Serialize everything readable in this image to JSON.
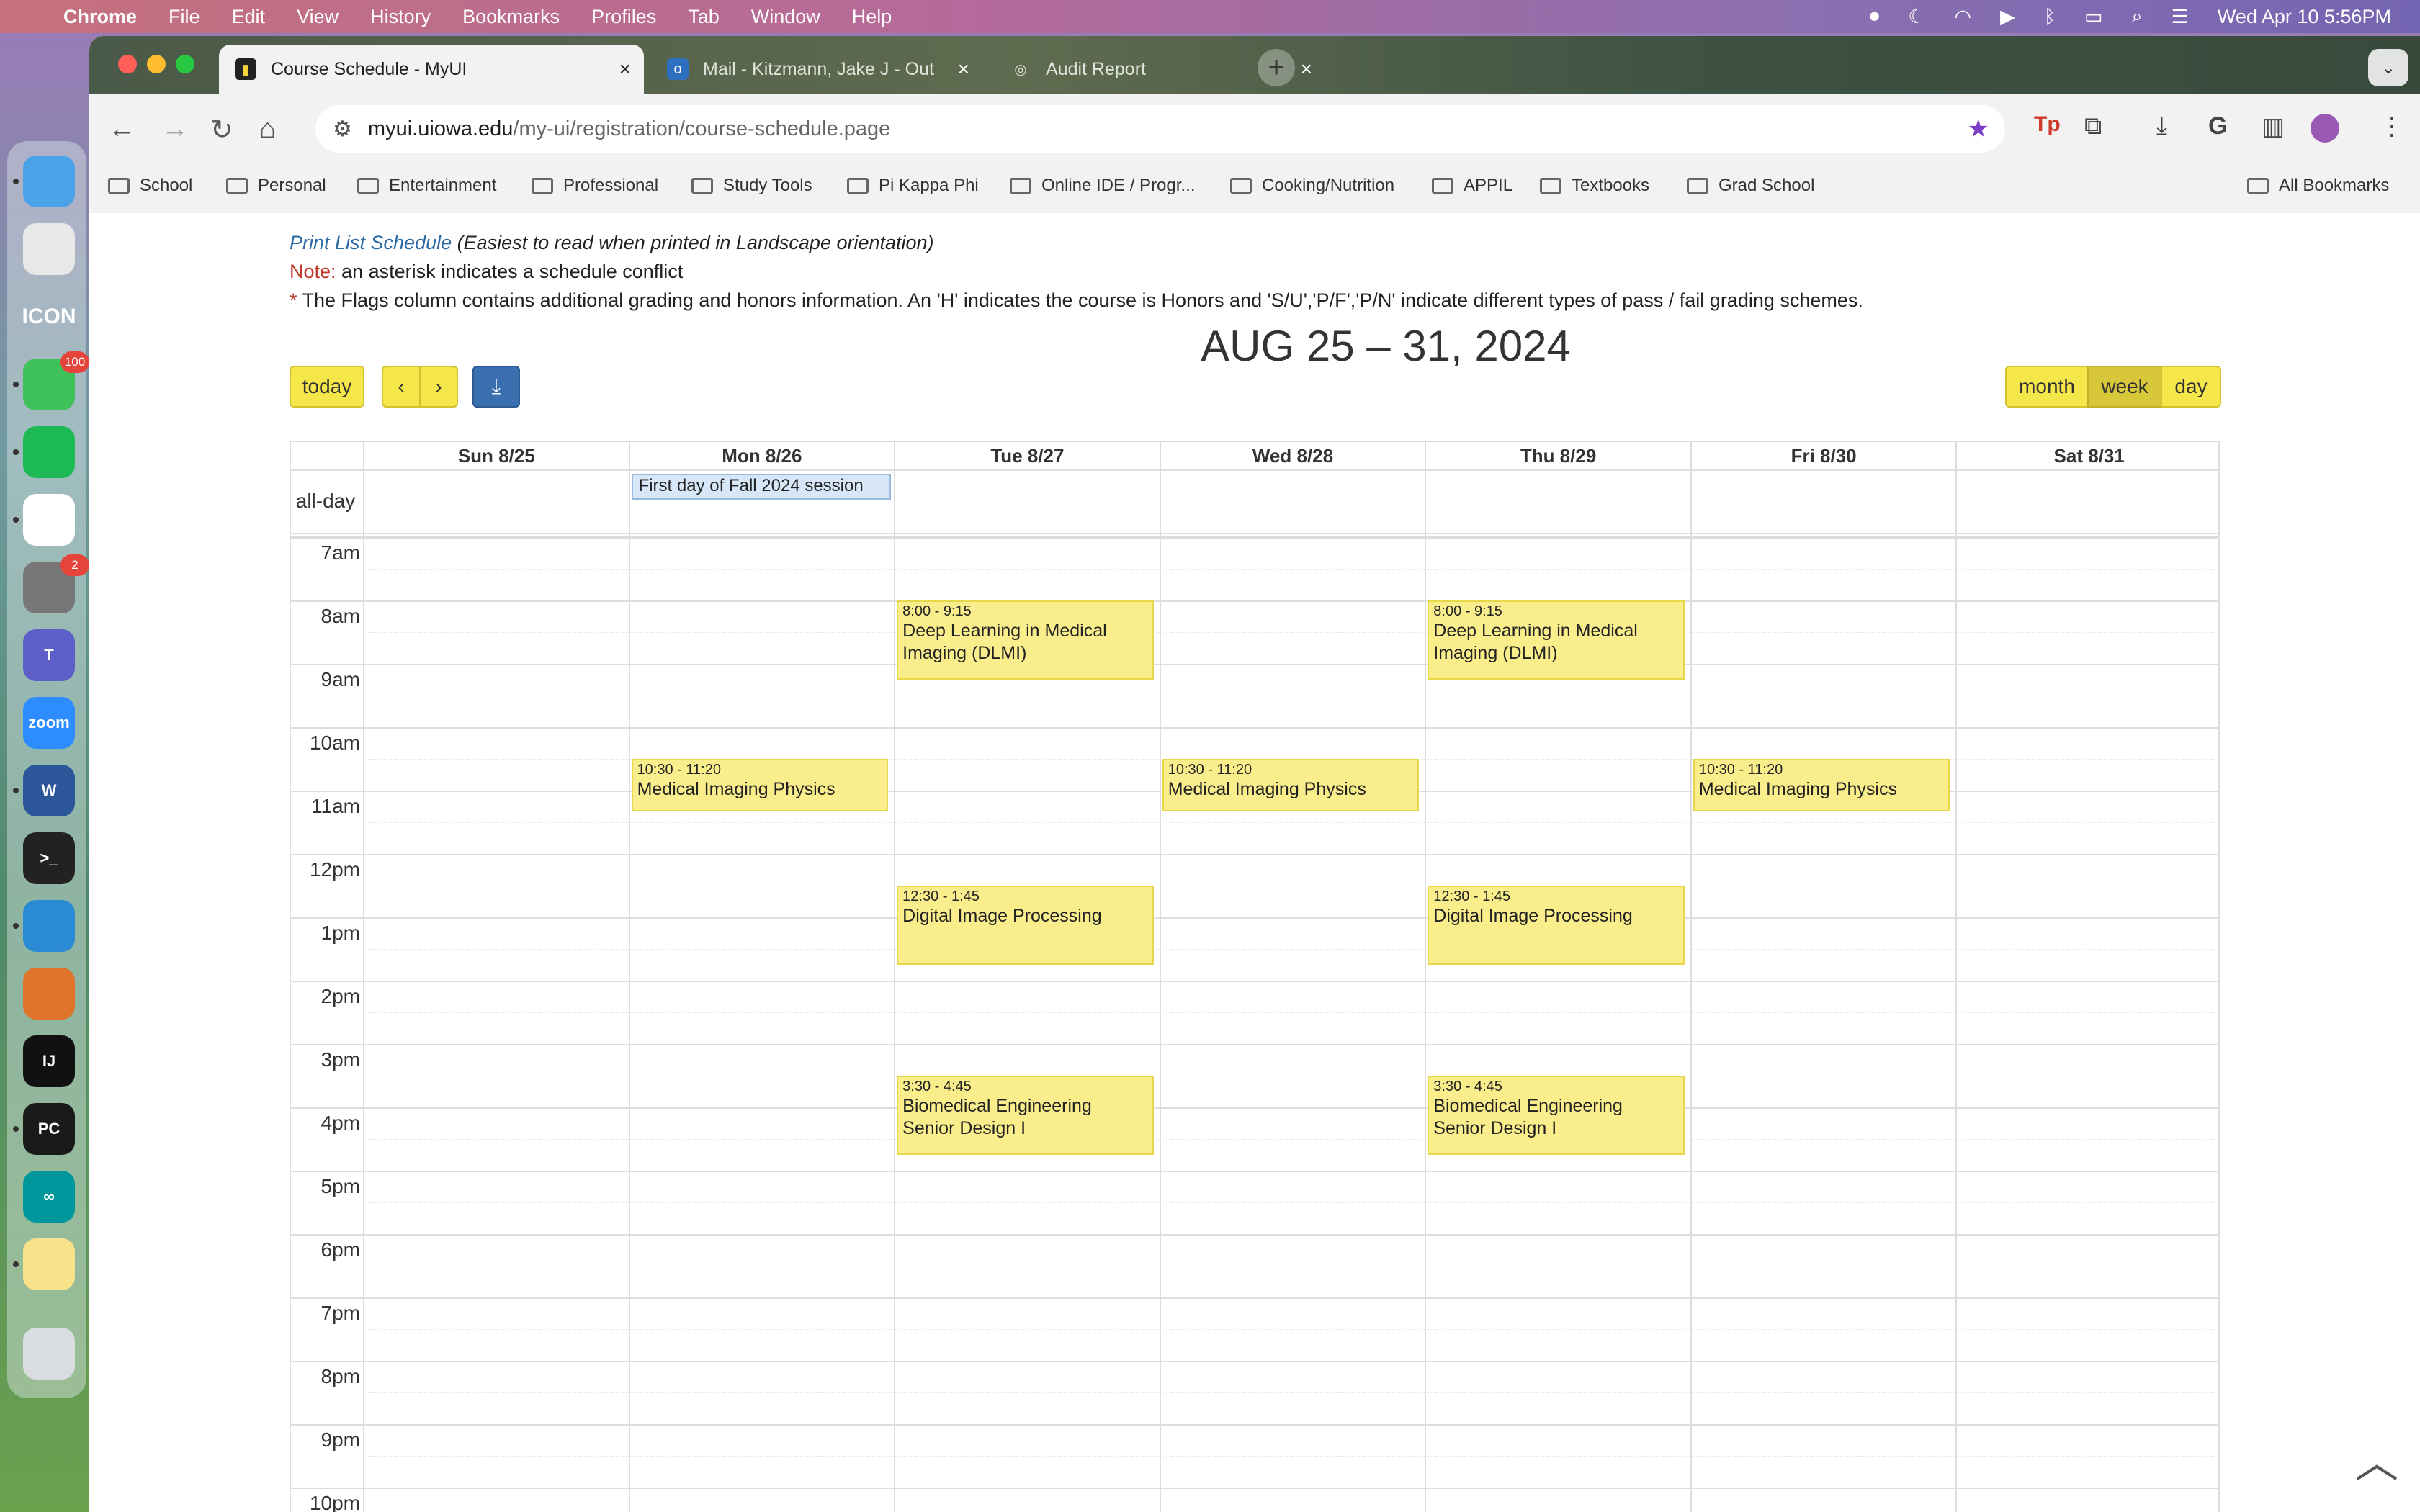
{
  "menubar": {
    "app": "Chrome",
    "items": [
      "File",
      "Edit",
      "View",
      "History",
      "Bookmarks",
      "Profiles",
      "Tab",
      "Window",
      "Help"
    ],
    "datetime": "Wed Apr 10  5:56PM"
  },
  "dock": {
    "apps": [
      {
        "name": "finder-icon",
        "label": "",
        "color": "#4aa3e8"
      },
      {
        "name": "launchpad-icon",
        "label": "",
        "color": "#e8e8e8"
      },
      {
        "name": "icon-app-icon",
        "label": "ICON",
        "color": "transparent"
      },
      {
        "name": "messages-icon",
        "label": "",
        "color": "#3fc15a",
        "badge": "100"
      },
      {
        "name": "spotify-icon",
        "label": "",
        "color": "#1db954"
      },
      {
        "name": "chrome-icon",
        "label": "",
        "color": "#ffffff"
      },
      {
        "name": "system-settings-icon",
        "label": "",
        "color": "#777",
        "badge": "2"
      },
      {
        "name": "teams-icon",
        "label": "T",
        "color": "#5b5fc7"
      },
      {
        "name": "zoom-icon",
        "label": "zoom",
        "color": "#2d8cff"
      },
      {
        "name": "word-icon",
        "label": "W",
        "color": "#2b579a"
      },
      {
        "name": "terminal-icon",
        "label": ">_",
        "color": "#222"
      },
      {
        "name": "vscode-icon",
        "label": "",
        "color": "#2a8ad4"
      },
      {
        "name": "matlab-icon",
        "label": "",
        "color": "#e0742a"
      },
      {
        "name": "intellij-icon",
        "label": "IJ",
        "color": "#111"
      },
      {
        "name": "pycharm-icon",
        "label": "PC",
        "color": "#1a1a1a"
      },
      {
        "name": "arduino-icon",
        "label": "∞",
        "color": "#00979c"
      },
      {
        "name": "notes-icon",
        "label": "",
        "color": "#f8e38a"
      },
      {
        "name": "trash-icon",
        "label": "",
        "color": "#d9dde0"
      }
    ]
  },
  "browser": {
    "tabs": [
      {
        "title": "Course Schedule - MyUI",
        "active": true
      },
      {
        "title": "Mail - Kitzmann, Jake J - Out",
        "active": false
      },
      {
        "title": "Audit Report",
        "active": false
      }
    ],
    "url_host": "myui.uiowa.edu",
    "url_path": "/my-ui/registration/course-schedule.page",
    "bookmarks": [
      "School",
      "Personal",
      "Entertainment",
      "Professional",
      "Study Tools",
      "Pi Kappa Phi",
      "Online IDE / Progr...",
      "Cooking/Nutrition",
      "APPIL",
      "Textbooks",
      "Grad School"
    ],
    "all_bookmarks": "All Bookmarks"
  },
  "page": {
    "print_link": "Print List Schedule",
    "print_hint": " (Easiest to read when printed in Landscape orientation)",
    "note_label": "Note:",
    "note_text": " an asterisk indicates a schedule conflict",
    "flags_star": "*",
    "flags_text": " The Flags column contains additional grading and honors information. An 'H' indicates the course is Honors and 'S/U','P/F','P/N' indicate different types of pass / fail grading schemes."
  },
  "calendar": {
    "today_label": "today",
    "title": "AUG 25 – 31, 2024",
    "views": [
      "month",
      "week",
      "day"
    ],
    "active_view": "week",
    "days": [
      "Sun 8/25",
      "Mon 8/26",
      "Tue 8/27",
      "Wed 8/28",
      "Thu 8/29",
      "Fri 8/30",
      "Sat 8/31"
    ],
    "allday_label": "all-day",
    "allday_events": [
      {
        "day": 1,
        "title": "First day of Fall 2024 session"
      }
    ],
    "hours": [
      "7am",
      "8am",
      "9am",
      "10am",
      "11am",
      "12pm",
      "1pm",
      "2pm",
      "3pm",
      "4pm",
      "5pm",
      "6pm",
      "7pm",
      "8pm",
      "9pm",
      "10pm"
    ],
    "events": [
      {
        "day": 2,
        "time": "8:00 - 9:15",
        "title": "Deep Learning in Medical Imaging (DLMI)",
        "start": 8.0,
        "end": 9.25
      },
      {
        "day": 4,
        "time": "8:00 - 9:15",
        "title": "Deep Learning in Medical Imaging (DLMI)",
        "start": 8.0,
        "end": 9.25
      },
      {
        "day": 1,
        "time": "10:30 - 11:20",
        "title": "Medical Imaging Physics",
        "start": 10.5,
        "end": 11.333
      },
      {
        "day": 3,
        "time": "10:30 - 11:20",
        "title": "Medical Imaging Physics",
        "start": 10.5,
        "end": 11.333
      },
      {
        "day": 5,
        "time": "10:30 - 11:20",
        "title": "Medical Imaging Physics",
        "start": 10.5,
        "end": 11.333
      },
      {
        "day": 2,
        "time": "12:30 - 1:45",
        "title": "Digital Image Processing",
        "start": 12.5,
        "end": 13.75
      },
      {
        "day": 4,
        "time": "12:30 - 1:45",
        "title": "Digital Image Processing",
        "start": 12.5,
        "end": 13.75
      },
      {
        "day": 2,
        "time": "3:30 - 4:45",
        "title": "Biomedical Engineering Senior Design I",
        "start": 15.5,
        "end": 16.75
      },
      {
        "day": 4,
        "time": "3:30 - 4:45",
        "title": "Biomedical Engineering Senior Design I",
        "start": 15.5,
        "end": 16.75
      }
    ]
  }
}
